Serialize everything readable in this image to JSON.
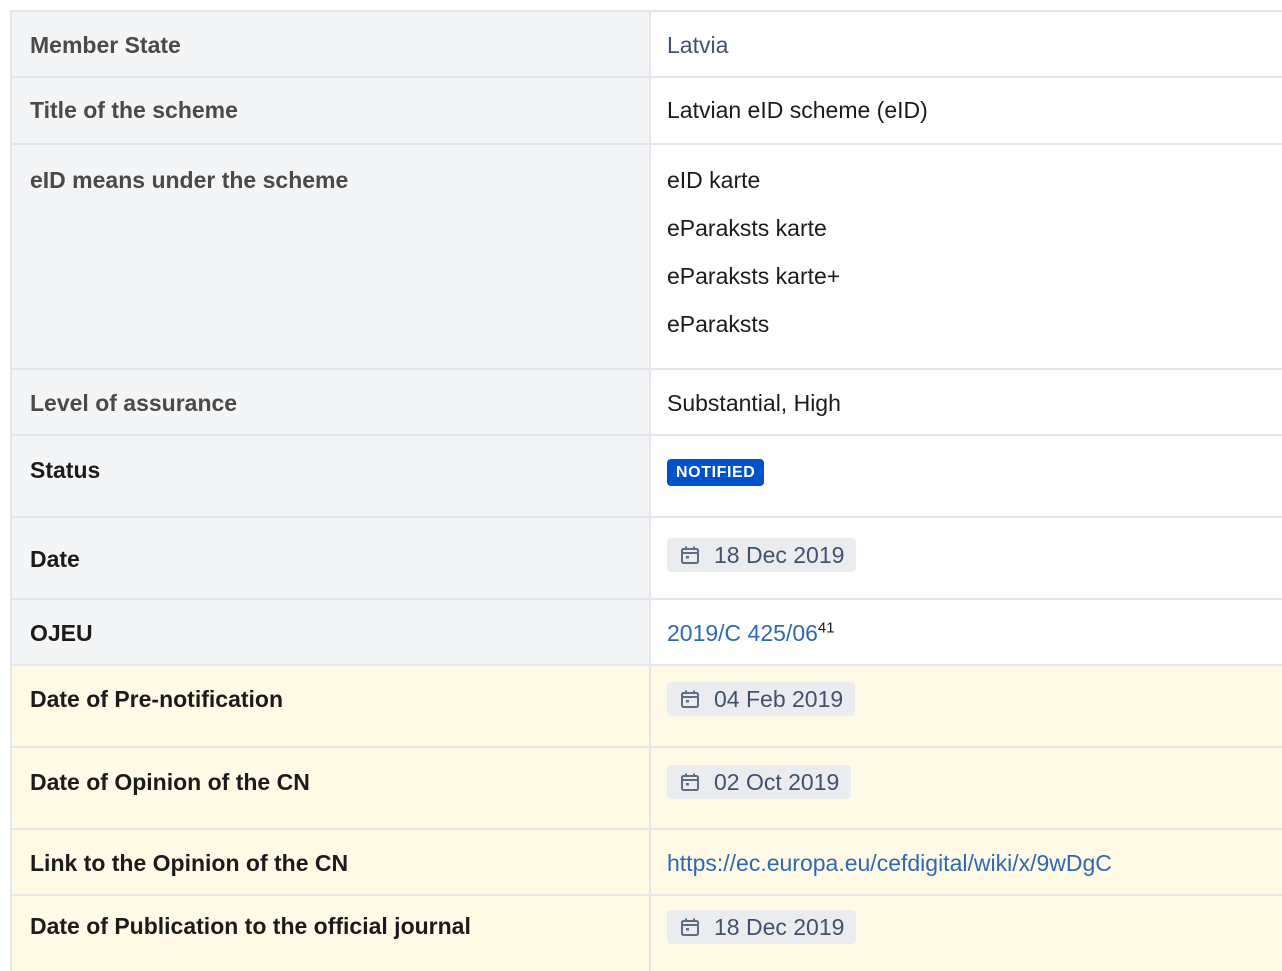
{
  "rows": [
    {
      "label": "Member State",
      "value": "Latvia"
    },
    {
      "label": "Title of the scheme",
      "value": "Latvian eID scheme (eID)"
    },
    {
      "label": "eID means under the scheme",
      "values": [
        "eID karte",
        "eParaksts karte",
        "eParaksts karte+",
        "eParaksts"
      ]
    },
    {
      "label": "Level of assurance",
      "value": "Substantial, High"
    },
    {
      "label": "Status",
      "badge": "NOTIFIED"
    },
    {
      "label": "Date",
      "date": "18 Dec 2019"
    },
    {
      "label": "OJEU",
      "link": "2019/C 425/06",
      "footnote": "41"
    },
    {
      "label": "Date of Pre-notification",
      "date": "04 Feb 2019"
    },
    {
      "label": "Date of Opinion of the CN",
      "date": "02 Oct 2019"
    },
    {
      "label": "Link to the Opinion of the CN",
      "link": "https://ec.europa.eu/cefdigital/wiki/x/9wDgC"
    },
    {
      "label": "Date of Publication to the official journal",
      "date": "18 Dec 2019"
    }
  ],
  "colors": {
    "label_bg": "#f4f5f7",
    "highlight_bg": "#fffae6",
    "badge_bg": "#0052cc",
    "link": "#2d6ab4",
    "chip_bg": "#ebecf0"
  },
  "icons": {
    "date": "calendar-icon"
  }
}
